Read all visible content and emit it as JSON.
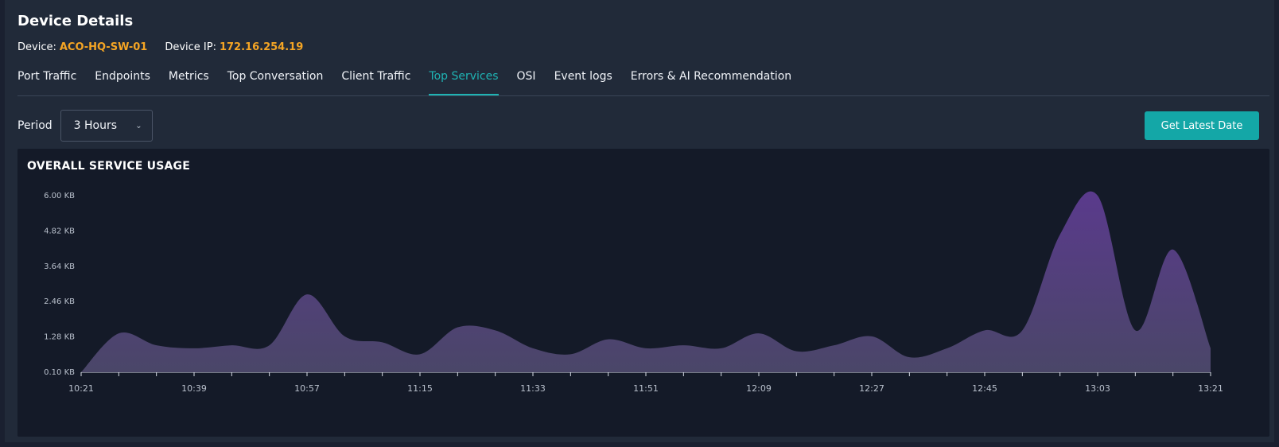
{
  "page": {
    "title": "Device Details"
  },
  "device": {
    "device_label": "Device:",
    "device_name": "ACO-HQ-SW-01",
    "ip_label": "Device IP:",
    "ip_value": "172.16.254.19"
  },
  "tabs": [
    {
      "label": "Port Traffic",
      "active": false
    },
    {
      "label": "Endpoints",
      "active": false
    },
    {
      "label": "Metrics",
      "active": false
    },
    {
      "label": "Top Conversation",
      "active": false
    },
    {
      "label": "Client Traffic",
      "active": false
    },
    {
      "label": "Top Services",
      "active": true
    },
    {
      "label": "OSI",
      "active": false
    },
    {
      "label": "Event logs",
      "active": false
    },
    {
      "label": "Errors & AI Recommendation",
      "active": false
    }
  ],
  "controls": {
    "period_label": "Period",
    "period_value": "3 Hours",
    "latest_button": "Get Latest Date"
  },
  "chart_title": "OVERALL SERVICE USAGE",
  "colors": {
    "accent": "#14a7a7",
    "highlight": "#f5a524",
    "area_top": "#5a3a8c",
    "area_bottom": "#4a4668"
  },
  "icons": {
    "dropdown": "chevron-down-icon"
  },
  "chart_data": {
    "type": "area",
    "title": "OVERALL SERVICE USAGE",
    "y_ticks": [
      "0.10 KB",
      "1.28 KB",
      "2.46 KB",
      "3.64 KB",
      "4.82 KB",
      "6.00 KB"
    ],
    "ylim": [
      0.1,
      6.0
    ],
    "x_ticks": [
      "10:21",
      "10:39",
      "10:57",
      "11:15",
      "11:33",
      "11:51",
      "12:09",
      "12:27",
      "12:45",
      "13:03",
      "13:21"
    ],
    "x_minutes": [
      0,
      6,
      12,
      18,
      24,
      30,
      36,
      42,
      48,
      54,
      60,
      66,
      72,
      78,
      84,
      90,
      96,
      102,
      108,
      114,
      120,
      126,
      132,
      138,
      144,
      150,
      156,
      162,
      168,
      174,
      180
    ],
    "series": [
      {
        "values": [
          0.1,
          1.4,
          1.0,
          0.9,
          1.0,
          1.0,
          2.7,
          1.3,
          1.1,
          0.7,
          1.6,
          1.5,
          0.9,
          0.7,
          1.2,
          0.9,
          1.0,
          0.9,
          1.4,
          0.8,
          1.0,
          1.3,
          0.6,
          0.9,
          1.5,
          1.5,
          4.7,
          6.0,
          1.5,
          4.2,
          0.9
        ]
      }
    ],
    "legend": "none",
    "grid": false
  }
}
